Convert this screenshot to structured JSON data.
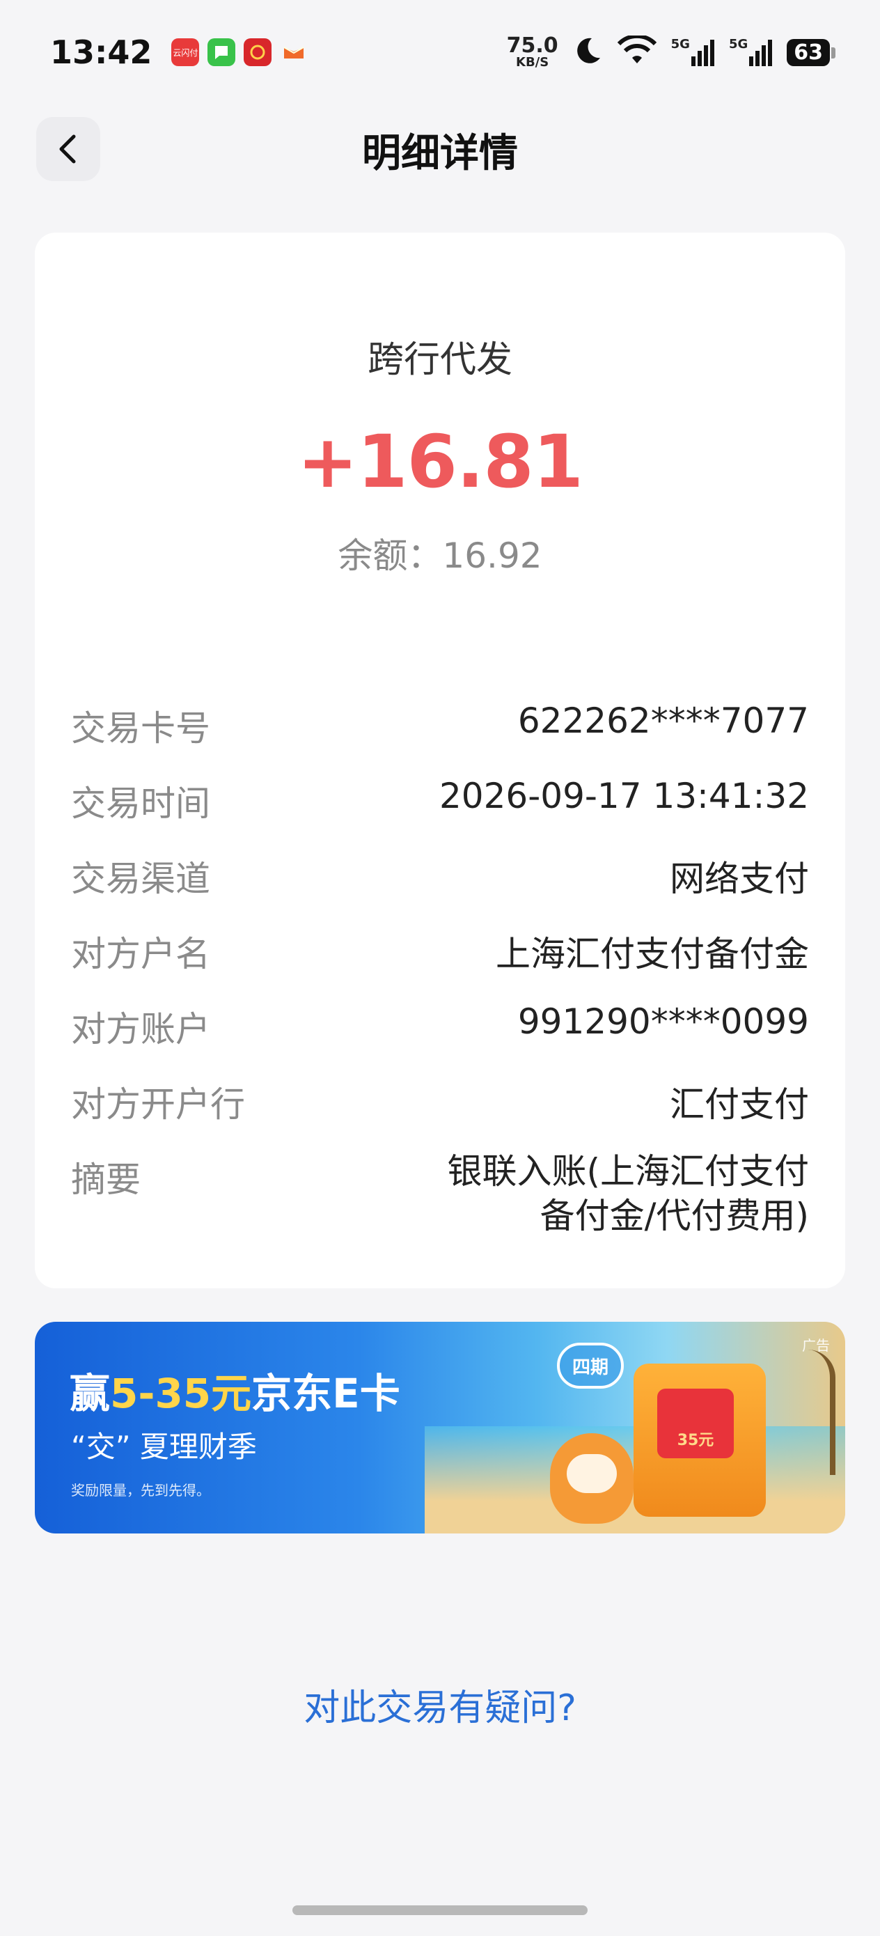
{
  "status_bar": {
    "time": "13:42",
    "notifications": [
      {
        "icon": "cloud-pay-icon",
        "color": "#e83a3a",
        "text": "云闪付"
      },
      {
        "icon": "messages-icon",
        "color": "#39c24a",
        "text": ""
      },
      {
        "icon": "bank-app-icon",
        "color": "#d8272b",
        "text": ""
      },
      {
        "icon": "game-icon",
        "color": "#f06a2a",
        "text": ""
      }
    ],
    "net_speed_value": "75.0",
    "net_speed_unit": "KB/S",
    "signal_1": "5G",
    "signal_2": "5G",
    "battery": "63"
  },
  "header": {
    "title": "明细详情"
  },
  "detail": {
    "type": "跨行代发",
    "amount": "+16.81",
    "balance": "余额：16.92",
    "rows": [
      {
        "label": "交易卡号",
        "value": "622262****7077"
      },
      {
        "label": "交易时间",
        "value": "2026-09-17 13:41:32"
      },
      {
        "label": "交易渠道",
        "value": "网络支付"
      },
      {
        "label": "对方户名",
        "value": "上海汇付支付备付金"
      },
      {
        "label": "对方账户",
        "value": "991290****0099"
      },
      {
        "label": "对方开户行",
        "value": "汇付支付"
      },
      {
        "label": "摘要",
        "value": "银联入账(上海汇付支付备付金/代付费用)"
      }
    ]
  },
  "banner": {
    "ad_tag": "广告",
    "title_prefix": "赢",
    "title_highlight": "5-35元",
    "title_suffix": "京东E卡",
    "subtitle": "“交” 夏理财季",
    "note": "奖励限量，先到先得。",
    "period_badge": "四期",
    "envelope_amount": "35元"
  },
  "question_link": "对此交易有疑问?"
}
